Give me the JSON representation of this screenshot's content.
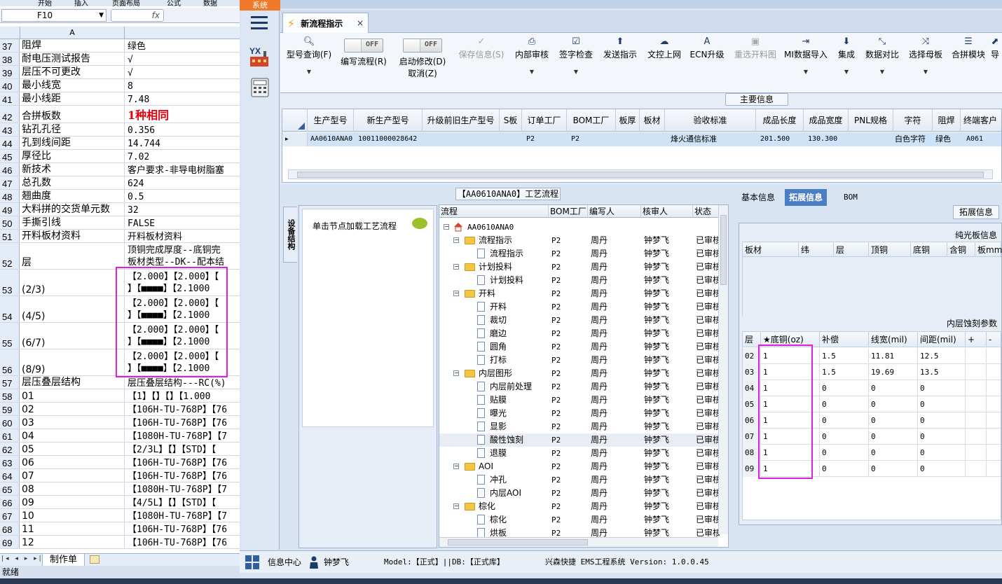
{
  "excel": {
    "ribbon_items": [
      "开始",
      "插入",
      "页面布局",
      "公式",
      "数据"
    ],
    "namebox": "F10",
    "fx": "fx",
    "col_header": "A",
    "rows": [
      {
        "n": "37",
        "a": "阻焊",
        "b": "绿色"
      },
      {
        "n": "38",
        "a": "耐电压测试报告",
        "b": "√"
      },
      {
        "n": "39",
        "a": "层压不可更改",
        "b": "√"
      },
      {
        "n": "40",
        "a": "最小线宽",
        "b": "8"
      },
      {
        "n": "41",
        "a": "最小线距",
        "b": "7.48"
      },
      {
        "n": "42",
        "a": "合拼板数",
        "b": "1种相同"
      },
      {
        "n": "43",
        "a": "钻孔孔径",
        "b": "0.356"
      },
      {
        "n": "44",
        "a": "孔到线间距",
        "b": "14.744"
      },
      {
        "n": "45",
        "a": "厚径比",
        "b": "7.02"
      },
      {
        "n": "46",
        "a": "新技术",
        "b": "客户要求-非导电树脂塞"
      },
      {
        "n": "47",
        "a": "总孔数",
        "b": "624"
      },
      {
        "n": "48",
        "a": "翘曲度",
        "b": "0.5"
      },
      {
        "n": "49",
        "a": "大料拼的交货单元数",
        "b": "32"
      },
      {
        "n": "50",
        "a": "手撕引线",
        "b": "FALSE"
      },
      {
        "n": "51",
        "a": "开料板材资料",
        "b": "开料板材资料"
      },
      {
        "n": "52",
        "a": "层",
        "b": "顶铜完成厚度--底铜完",
        "b2": "板材类型--DK--配本结"
      },
      {
        "n": "53",
        "a": "(2/3)",
        "b": "【2.000】【2.000】【",
        "b2": "】【■■■■】【2.1000"
      },
      {
        "n": "54",
        "a": "(4/5)",
        "b": "【2.000】【2.000】【",
        "b2": "】【■■■■】【2.1000"
      },
      {
        "n": "55",
        "a": "(6/7)",
        "b": "【2.000】【2.000】【",
        "b2": "】【■■■■】【2.1000"
      },
      {
        "n": "56",
        "a": "(8/9)",
        "b": "【2.000】【2.000】【",
        "b2": "】【■■■■】【2.1000"
      },
      {
        "n": "57",
        "a": "层压叠层结构",
        "b": "层压叠层结构---RC(%)"
      },
      {
        "n": "58",
        "a": "01",
        "b": "【1】【】【】【1.000"
      },
      {
        "n": "59",
        "a": "02",
        "b": "【106H-TU-768P】【76"
      },
      {
        "n": "60",
        "a": "03",
        "b": "【106H-TU-768P】【76"
      },
      {
        "n": "61",
        "a": "04",
        "b": "【1080H-TU-768P】【7"
      },
      {
        "n": "62",
        "a": "05",
        "b": "【2/3L】【】【STD】【"
      },
      {
        "n": "63",
        "a": "06",
        "b": "【106H-TU-768P】【76"
      },
      {
        "n": "64",
        "a": "07",
        "b": "【106H-TU-768P】【76"
      },
      {
        "n": "65",
        "a": "08",
        "b": "【1080H-TU-768P】【7"
      },
      {
        "n": "66",
        "a": "09",
        "b": "【4/5L】【】【STD】【"
      },
      {
        "n": "67",
        "a": "10",
        "b": "【1080H-TU-768P】【7"
      },
      {
        "n": "68",
        "a": "11",
        "b": "【106H-TU-768P】【76"
      },
      {
        "n": "69",
        "a": "12",
        "b": "【106H-TU-768P】【76"
      }
    ],
    "sheet_nav": "|◂ ◂ ▸ ▸|",
    "sheet_tab": "制作单",
    "status": "就绪"
  },
  "app": {
    "system_label": "系统",
    "tab_title": "新流程指示",
    "tab_close": "×",
    "toolbar": {
      "model_query": "型号查询(F)",
      "edit_flow": "编写流程(R)",
      "start_modify": "启动修改(D)",
      "cancel": "取消(Z)",
      "toggle_off": "OFF",
      "save_info": "保存信息(S)",
      "internal_review": "内部审核",
      "sign_check": "签字检查",
      "send_instruction": "发送指示",
      "upload_doc": "文控上网",
      "ecn_upgrade": "ECN升级",
      "reselect_cut": "重选开料图",
      "mi_import": "MI数据导入",
      "integrate": "集成",
      "data_compare": "数据对比",
      "select_parent": "选择母板",
      "merge_module": "合拼模块",
      "more": "导"
    },
    "main_info": {
      "title": "主要信息",
      "headers": [
        "生产型号",
        "新生产型号",
        "升级前旧生产型号",
        "S板",
        "订单工厂",
        "BOM工厂",
        "板厚",
        "板材",
        "验收标准",
        "成品长度",
        "成品宽度",
        "PNL规格",
        "字符",
        "阻焊",
        "终端客户"
      ],
      "row": {
        "sel": "▸",
        "prod_no": "AA0610ANA0",
        "new_prod_no": "10011000028642",
        "old_prod_no": "",
        "s_board": "",
        "order_factory": "P2",
        "bom_factory": "P2",
        "thickness": "",
        "material": "",
        "standard": "烽火通信标准",
        "length": "201.500",
        "width": "130.300",
        "pnl": "",
        "char": "白色字符",
        "mask": "绿色",
        "customer": "A061"
      }
    },
    "process": {
      "title": "【AA0610ANA0】工艺流程",
      "side_tab": "设备结构",
      "node_label": "单击节点加载工艺流程",
      "headers": [
        "流程",
        "BOM工厂",
        "编写人",
        "核审人",
        "状态"
      ],
      "rows": [
        {
          "level": 0,
          "type": "home",
          "name": "AA0610ANA0",
          "bom": "",
          "writer": "",
          "reviewer": "",
          "status": ""
        },
        {
          "level": 1,
          "type": "folder",
          "name": "流程指示",
          "bom": "P2",
          "writer": "周丹",
          "reviewer": "钟梦飞",
          "status": "已审核"
        },
        {
          "level": 2,
          "type": "doc",
          "name": "流程指示",
          "bom": "P2",
          "writer": "周丹",
          "reviewer": "钟梦飞",
          "status": "已审核"
        },
        {
          "level": 1,
          "type": "folder",
          "name": "计划投料",
          "bom": "P2",
          "writer": "周丹",
          "reviewer": "钟梦飞",
          "status": "已审核"
        },
        {
          "level": 2,
          "type": "doc",
          "name": "计划投料",
          "bom": "P2",
          "writer": "周丹",
          "reviewer": "钟梦飞",
          "status": "已审核"
        },
        {
          "level": 1,
          "type": "folder",
          "name": "开料",
          "bom": "P2",
          "writer": "周丹",
          "reviewer": "钟梦飞",
          "status": "已审核"
        },
        {
          "level": 2,
          "type": "doc",
          "name": "开料",
          "bom": "P2",
          "writer": "周丹",
          "reviewer": "钟梦飞",
          "status": "已审核"
        },
        {
          "level": 2,
          "type": "doc",
          "name": "裁切",
          "bom": "P2",
          "writer": "周丹",
          "reviewer": "钟梦飞",
          "status": "已审核"
        },
        {
          "level": 2,
          "type": "doc",
          "name": "磨边",
          "bom": "P2",
          "writer": "周丹",
          "reviewer": "钟梦飞",
          "status": "已审核"
        },
        {
          "level": 2,
          "type": "doc",
          "name": "圆角",
          "bom": "P2",
          "writer": "周丹",
          "reviewer": "钟梦飞",
          "status": "已审核"
        },
        {
          "level": 2,
          "type": "doc",
          "name": "打标",
          "bom": "P2",
          "writer": "周丹",
          "reviewer": "钟梦飞",
          "status": "已审核"
        },
        {
          "level": 1,
          "type": "folder",
          "name": "内层图形",
          "bom": "P2",
          "writer": "周丹",
          "reviewer": "钟梦飞",
          "status": "已审核"
        },
        {
          "level": 2,
          "type": "doc",
          "name": "内层前处理",
          "bom": "P2",
          "writer": "周丹",
          "reviewer": "钟梦飞",
          "status": "已审核"
        },
        {
          "level": 2,
          "type": "doc",
          "name": "贴膜",
          "bom": "P2",
          "writer": "周丹",
          "reviewer": "钟梦飞",
          "status": "已审核"
        },
        {
          "level": 2,
          "type": "doc",
          "name": "曝光",
          "bom": "P2",
          "writer": "周丹",
          "reviewer": "钟梦飞",
          "status": "已审核"
        },
        {
          "level": 2,
          "type": "doc",
          "name": "显影",
          "bom": "P2",
          "writer": "周丹",
          "reviewer": "钟梦飞",
          "status": "已审核"
        },
        {
          "level": 2,
          "type": "doc",
          "name": "酸性蚀刻",
          "bom": "P2",
          "writer": "周丹",
          "reviewer": "钟梦飞",
          "status": "已审核",
          "hl": true
        },
        {
          "level": 2,
          "type": "doc",
          "name": "退膜",
          "bom": "P2",
          "writer": "周丹",
          "reviewer": "钟梦飞",
          "status": "已审核"
        },
        {
          "level": 1,
          "type": "folder",
          "name": "AOI",
          "bom": "P2",
          "writer": "周丹",
          "reviewer": "钟梦飞",
          "status": "已审核"
        },
        {
          "level": 2,
          "type": "doc",
          "name": "冲孔",
          "bom": "P2",
          "writer": "周丹",
          "reviewer": "钟梦飞",
          "status": "已审核"
        },
        {
          "level": 2,
          "type": "doc",
          "name": "内层AOI",
          "bom": "P2",
          "writer": "周丹",
          "reviewer": "钟梦飞",
          "status": "已审核"
        },
        {
          "level": 1,
          "type": "folder",
          "name": "棕化",
          "bom": "P2",
          "writer": "周丹",
          "reviewer": "钟梦飞",
          "status": "已审核"
        },
        {
          "level": 2,
          "type": "doc",
          "name": "棕化",
          "bom": "P2",
          "writer": "周丹",
          "reviewer": "钟梦飞",
          "status": "已审核"
        },
        {
          "level": 2,
          "type": "doc",
          "name": "烘板",
          "bom": "P2",
          "writer": "周丹",
          "reviewer": "钟梦飞",
          "status": "已审核"
        }
      ]
    },
    "right": {
      "tabs": [
        "基本信息",
        "拓展信息",
        "BOM"
      ],
      "ext_title": "拓展信息",
      "board_title": "纯光板信息",
      "board_headers": [
        "板材",
        "纬",
        "层",
        "顶铜",
        "底铜",
        "含铜",
        "板mm"
      ],
      "layer_title": "内层蚀刻参数",
      "layer_headers": [
        "层",
        "★底铜(oz)",
        "补偿",
        "线宽(mil)",
        "间距(mil)",
        "+",
        "-"
      ],
      "layer_rows": [
        [
          "02",
          "1",
          "1.5",
          "11.81",
          "12.5"
        ],
        [
          "03",
          "1",
          "1.5",
          "19.69",
          "13.5"
        ],
        [
          "04",
          "1",
          "0",
          "0",
          "0"
        ],
        [
          "05",
          "1",
          "0",
          "0",
          "0"
        ],
        [
          "06",
          "1",
          "0",
          "0",
          "0"
        ],
        [
          "07",
          "1",
          "0",
          "0",
          "0"
        ],
        [
          "08",
          "1",
          "0",
          "0",
          "0"
        ],
        [
          "09",
          "1",
          "0",
          "0",
          "0"
        ]
      ]
    },
    "statusbar": {
      "info_center": "信息中心",
      "user": "钟梦飞",
      "model": "Model:【正式】||DB:【正式库】",
      "system": "兴森快捷 EMS工程系统 Version: 1.0.0.45"
    },
    "colors": {
      "accent": "#4a7ec4",
      "highlight": "#e020d8",
      "red_text": "#e0000f",
      "sys_orange": "#f07a2a"
    }
  }
}
